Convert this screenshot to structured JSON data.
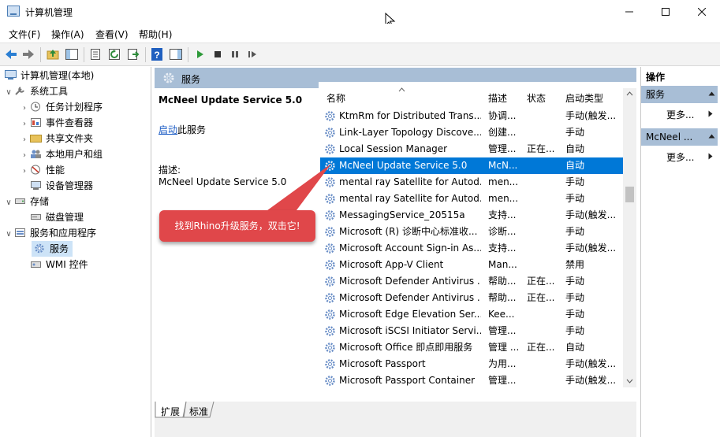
{
  "window": {
    "title": "计算机管理",
    "controls": [
      "minimize-icon",
      "maximize-icon",
      "close-icon"
    ]
  },
  "menu": [
    "文件(F)",
    "操作(A)",
    "查看(V)",
    "帮助(H)"
  ],
  "toolbar": {
    "icons": [
      "back-arrow-icon",
      "forward-arrow-icon",
      "up-folder-icon",
      "show-tree-icon",
      "properties-icon",
      "refresh-icon",
      "export-icon",
      "help-icon",
      "show-pane-icon",
      "play-icon",
      "stop-icon",
      "pause-icon",
      "resume-icon"
    ]
  },
  "tree": {
    "items": [
      {
        "label": "计算机管理(本地)",
        "arrow": "",
        "level": 0
      },
      {
        "label": "系统工具",
        "arrow": "∨",
        "level": 1
      },
      {
        "label": "任务计划程序",
        "arrow": "›",
        "level": 2
      },
      {
        "label": "事件查看器",
        "arrow": "›",
        "level": 2
      },
      {
        "label": "共享文件夹",
        "arrow": "›",
        "level": 2
      },
      {
        "label": "本地用户和组",
        "arrow": "›",
        "level": 2
      },
      {
        "label": "性能",
        "arrow": "›",
        "level": 2
      },
      {
        "label": "设备管理器",
        "arrow": "",
        "level": 2
      },
      {
        "label": "存储",
        "arrow": "∨",
        "level": 1
      },
      {
        "label": "磁盘管理",
        "arrow": "",
        "level": 2
      },
      {
        "label": "服务和应用程序",
        "arrow": "∨",
        "level": 1
      },
      {
        "label": "服务",
        "arrow": "",
        "level": 2
      },
      {
        "label": "WMI 控件",
        "arrow": "",
        "level": 2
      }
    ]
  },
  "center": {
    "header_title": "服务",
    "detail": {
      "service_name": "McNeel Update Service 5.0",
      "start_link": "启动",
      "start_suffix": "此服务",
      "desc_label": "描述:",
      "desc_text": "McNeel Update Service 5.0"
    },
    "columns": [
      "名称",
      "描述",
      "状态",
      "启动类型"
    ],
    "rows": [
      {
        "name": "KtmRm for Distributed Trans...",
        "desc": "协调...",
        "state": "",
        "start": "手动(触发..."
      },
      {
        "name": "Link-Layer Topology Discove...",
        "desc": "创建...",
        "state": "",
        "start": "手动"
      },
      {
        "name": "Local Session Manager",
        "desc": "管理...",
        "state": "正在...",
        "start": "自动"
      },
      {
        "name": "McNeel Update Service 5.0",
        "desc": "McN...",
        "state": "",
        "start": "自动"
      },
      {
        "name": "mental ray Satellite for Autod...",
        "desc": "men...",
        "state": "",
        "start": "手动"
      },
      {
        "name": "mental ray Satellite for Autod...",
        "desc": "men...",
        "state": "",
        "start": "手动"
      },
      {
        "name": "MessagingService_20515a",
        "desc": "支持...",
        "state": "",
        "start": "手动(触发..."
      },
      {
        "name": "Microsoft (R) 诊断中心标准收...",
        "desc": "诊断...",
        "state": "",
        "start": "手动"
      },
      {
        "name": "Microsoft Account Sign-in As...",
        "desc": "支持...",
        "state": "",
        "start": "手动(触发..."
      },
      {
        "name": "Microsoft App-V Client",
        "desc": "Man...",
        "state": "",
        "start": "禁用"
      },
      {
        "name": "Microsoft Defender Antivirus ...",
        "desc": "帮助...",
        "state": "正在...",
        "start": "手动"
      },
      {
        "name": "Microsoft Defender Antivirus ...",
        "desc": "帮助...",
        "state": "正在...",
        "start": "手动"
      },
      {
        "name": "Microsoft Edge Elevation Ser...",
        "desc": "Kee...",
        "state": "",
        "start": "手动"
      },
      {
        "name": "Microsoft iSCSI Initiator Servi...",
        "desc": "管理...",
        "state": "",
        "start": "手动"
      },
      {
        "name": "Microsoft Office 即点即用服务",
        "desc": "管理 ...",
        "state": "正在...",
        "start": "自动"
      },
      {
        "name": "Microsoft Passport",
        "desc": "为用...",
        "state": "",
        "start": "手动(触发..."
      },
      {
        "name": "Microsoft Passport Container",
        "desc": "管理...",
        "state": "",
        "start": "手动(触发..."
      }
    ],
    "selected_row": 3,
    "tabs": [
      "扩展",
      "标准"
    ]
  },
  "actions": {
    "title": "操作",
    "sections": [
      {
        "header": "服务",
        "item": "更多..."
      },
      {
        "header": "McNeel ...",
        "item": "更多..."
      }
    ]
  },
  "callout": {
    "text": "找到Rhino升级服务，双击它!",
    "color": "#e0474a"
  },
  "colors": {
    "selection": "#0078d7",
    "header_band": "#a8bed6",
    "tree_selection": "#cde3f7"
  }
}
